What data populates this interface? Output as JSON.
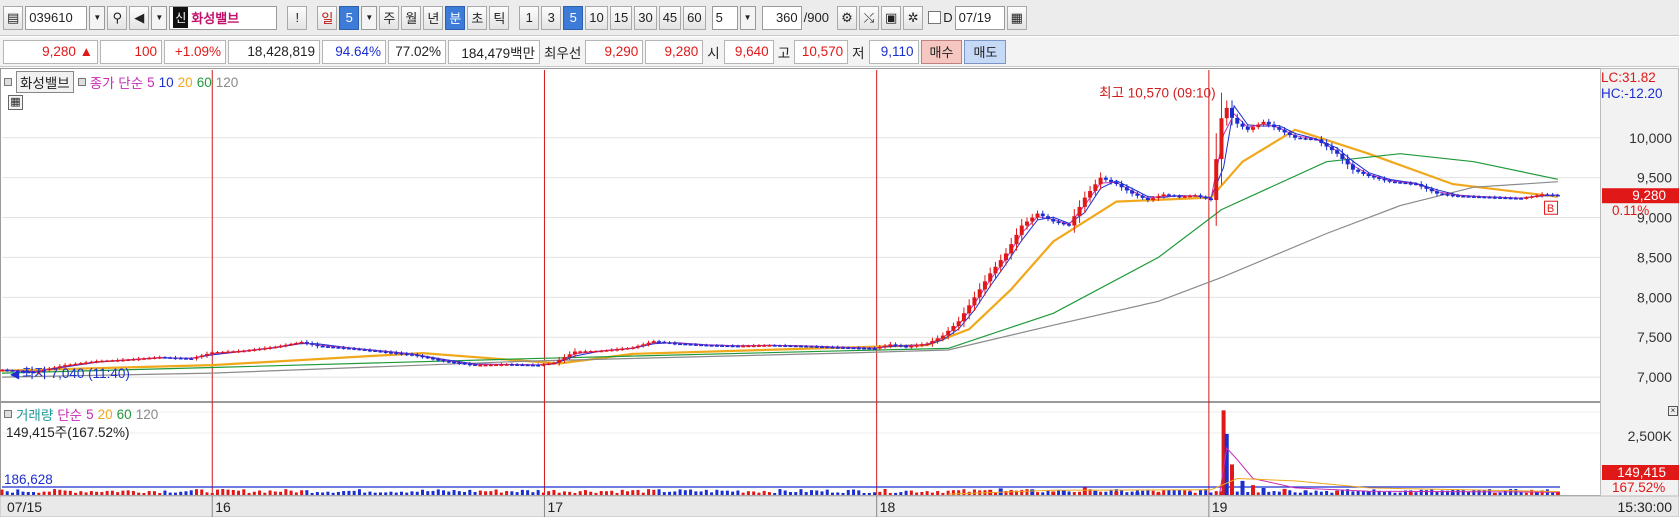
{
  "toolbar": {
    "code": "039610",
    "badge": "신",
    "name": "화성밸브",
    "exclaim": "!",
    "period_buttons": [
      "일",
      "5",
      "주",
      "월",
      "년",
      "분",
      "초",
      "틱"
    ],
    "minute_buttons": [
      "1",
      "3",
      "5",
      "10",
      "15",
      "30",
      "45",
      "60"
    ],
    "unit_value": "5",
    "count_value": "360",
    "count_total": "/900",
    "d_label": "D",
    "date": "07/19"
  },
  "quote": {
    "price": "9,280",
    "arrow": "▲",
    "change": "100",
    "change_pct": "+1.09%",
    "volume": "18,428,819",
    "ratio1": "94.64%",
    "ratio2": "77.02%",
    "amount": "184,479백만",
    "best_label": "최우선",
    "best_ask": "9,290",
    "best_bid": "9,280",
    "open_label": "시",
    "open": "9,640",
    "high_label": "고",
    "high": "10,570",
    "low_label": "저",
    "low": "9,110",
    "buy": "매수",
    "sell": "매도"
  },
  "price_pane": {
    "name": "화성밸브",
    "ma_label": "종가 단순",
    "ma_periods": [
      "5",
      "10",
      "20",
      "60",
      "120"
    ],
    "ma_colors": [
      "#c92bb4",
      "#1b2fd0",
      "#f0a81a",
      "#1f9a3a",
      "#8a8a8a"
    ],
    "lc": "LC:31.82",
    "hc": "HC:-12.20",
    "high_marker": "최고 10,570 (09:10)",
    "low_marker": "최저 7,040 (11:40)",
    "current_price_tag": "9,280",
    "current_pct_tag": "0.11%",
    "b_marker": "B"
  },
  "volume_pane": {
    "name": "거래량",
    "ma_label": "단순",
    "ma_periods": [
      "5",
      "20",
      "60",
      "120"
    ],
    "ma_colors": [
      "#c92bb4",
      "#f0a81a",
      "#1f9a3a",
      "#8a8a8a"
    ],
    "current": "149,415주(167.52%)",
    "level_label": "186,628",
    "current_tag": "149,415",
    "current_pct_tag": "167.52%"
  },
  "x_axis": {
    "labels": [
      "07/15",
      "16",
      "17",
      "18",
      "19"
    ],
    "time": "15:30:00"
  },
  "chart_data": {
    "type": "candlestick",
    "price_axis": {
      "ticks": [
        7000,
        7500,
        8000,
        8500,
        9000,
        9500,
        10000
      ],
      "tick_labels": [
        "7,000",
        "7,500",
        "8,000",
        "8,500",
        "9,000",
        "9,500",
        "10,000"
      ],
      "range": [
        6700,
        10850
      ]
    },
    "volume_axis": {
      "ticks": [
        2500000
      ],
      "tick_labels": [
        "2,500K"
      ],
      "range": [
        0,
        3700000
      ]
    },
    "price_path": [
      [
        0,
        7090
      ],
      [
        30,
        7060
      ],
      [
        60,
        7150
      ],
      [
        90,
        7200
      ],
      [
        120,
        7220
      ],
      [
        150,
        7250
      ],
      [
        180,
        7230
      ],
      [
        200,
        7310
      ],
      [
        230,
        7330
      ],
      [
        260,
        7380
      ],
      [
        285,
        7440
      ],
      [
        300,
        7390
      ],
      [
        330,
        7360
      ],
      [
        360,
        7320
      ],
      [
        390,
        7280
      ],
      [
        420,
        7200
      ],
      [
        450,
        7150
      ],
      [
        480,
        7160
      ],
      [
        510,
        7150
      ],
      [
        525,
        7180
      ],
      [
        545,
        7320
      ],
      [
        570,
        7330
      ],
      [
        600,
        7370
      ],
      [
        620,
        7450
      ],
      [
        640,
        7420
      ],
      [
        670,
        7400
      ],
      [
        700,
        7390
      ],
      [
        730,
        7400
      ],
      [
        760,
        7390
      ],
      [
        800,
        7370
      ],
      [
        830,
        7360
      ],
      [
        845,
        7410
      ],
      [
        860,
        7380
      ],
      [
        880,
        7420
      ],
      [
        895,
        7520
      ],
      [
        910,
        7700
      ],
      [
        925,
        8000
      ],
      [
        940,
        8300
      ],
      [
        955,
        8550
      ],
      [
        970,
        8900
      ],
      [
        985,
        9050
      ],
      [
        1000,
        8950
      ],
      [
        1015,
        8900
      ],
      [
        1030,
        9250
      ],
      [
        1045,
        9500
      ],
      [
        1060,
        9420
      ],
      [
        1075,
        9300
      ],
      [
        1090,
        9220
      ],
      [
        1105,
        9290
      ],
      [
        1120,
        9260
      ],
      [
        1135,
        9280
      ],
      [
        1150,
        9220
      ],
      [
        1162,
        10450
      ],
      [
        1172,
        10200
      ],
      [
        1185,
        10100
      ],
      [
        1200,
        10200
      ],
      [
        1215,
        10100
      ],
      [
        1230,
        10000
      ],
      [
        1250,
        9980
      ],
      [
        1270,
        9800
      ],
      [
        1285,
        9600
      ],
      [
        1300,
        9520
      ],
      [
        1320,
        9450
      ],
      [
        1345,
        9420
      ],
      [
        1365,
        9300
      ],
      [
        1385,
        9270
      ],
      [
        1405,
        9260
      ],
      [
        1425,
        9250
      ],
      [
        1445,
        9240
      ],
      [
        1465,
        9290
      ],
      [
        1480,
        9280
      ]
    ],
    "ma_series": [
      {
        "period": "20",
        "color": "#f0a81a",
        "points": [
          [
            0,
            7080
          ],
          [
            200,
            7150
          ],
          [
            400,
            7300
          ],
          [
            530,
            7170
          ],
          [
            600,
            7290
          ],
          [
            800,
            7370
          ],
          [
            880,
            7400
          ],
          [
            920,
            7600
          ],
          [
            960,
            8100
          ],
          [
            1000,
            8700
          ],
          [
            1060,
            9200
          ],
          [
            1150,
            9250
          ],
          [
            1180,
            9700
          ],
          [
            1230,
            10100
          ],
          [
            1300,
            9800
          ],
          [
            1380,
            9420
          ],
          [
            1480,
            9260
          ]
        ]
      },
      {
        "period": "60",
        "color": "#1f9a3a",
        "points": [
          [
            0,
            7050
          ],
          [
            200,
            7120
          ],
          [
            500,
            7230
          ],
          [
            800,
            7330
          ],
          [
            900,
            7360
          ],
          [
            1000,
            7800
          ],
          [
            1100,
            8500
          ],
          [
            1160,
            9100
          ],
          [
            1260,
            9700
          ],
          [
            1330,
            9800
          ],
          [
            1400,
            9700
          ],
          [
            1480,
            9480
          ]
        ]
      },
      {
        "period": "120",
        "color": "#8a8a8a",
        "points": [
          [
            0,
            7000
          ],
          [
            200,
            7050
          ],
          [
            500,
            7200
          ],
          [
            800,
            7300
          ],
          [
            900,
            7340
          ],
          [
            1000,
            7650
          ],
          [
            1100,
            7950
          ],
          [
            1160,
            8250
          ],
          [
            1260,
            8800
          ],
          [
            1330,
            9150
          ],
          [
            1400,
            9380
          ],
          [
            1480,
            9450
          ]
        ]
      }
    ],
    "volume_bars": [
      [
        940,
        220000
      ],
      [
        950,
        280000
      ],
      [
        960,
        180000
      ],
      [
        980,
        240000
      ],
      [
        1000,
        150000
      ],
      [
        1010,
        200000
      ],
      [
        1030,
        320000
      ],
      [
        1040,
        180000
      ],
      [
        1060,
        140000
      ],
      [
        1080,
        120000
      ],
      [
        1100,
        100000
      ],
      [
        1130,
        140000
      ],
      [
        1162,
        3600000
      ],
      [
        1165,
        2600000
      ],
      [
        1170,
        1300000
      ],
      [
        1180,
        600000
      ],
      [
        1190,
        420000
      ],
      [
        1200,
        300000
      ],
      [
        1220,
        260000
      ],
      [
        1240,
        200000
      ],
      [
        1270,
        180000
      ],
      [
        1300,
        150000
      ],
      [
        1340,
        120000
      ],
      [
        1380,
        100000
      ],
      [
        1420,
        90000
      ],
      [
        1460,
        110000
      ],
      [
        1480,
        149415
      ]
    ],
    "vol_ma_series": [
      {
        "period": "5",
        "color": "#c92bb4",
        "points": [
          [
            1158,
            0
          ],
          [
            1165,
            2000000
          ],
          [
            1175,
            1500000
          ],
          [
            1190,
            700000
          ],
          [
            1230,
            300000
          ],
          [
            1300,
            160000
          ],
          [
            1480,
            120000
          ]
        ]
      },
      {
        "period": "20",
        "color": "#f0a81a",
        "points": [
          [
            900,
            40000
          ],
          [
            1000,
            200000
          ],
          [
            1150,
            220000
          ],
          [
            1175,
            700000
          ],
          [
            1230,
            600000
          ],
          [
            1300,
            300000
          ],
          [
            1480,
            150000
          ]
        ]
      }
    ]
  }
}
